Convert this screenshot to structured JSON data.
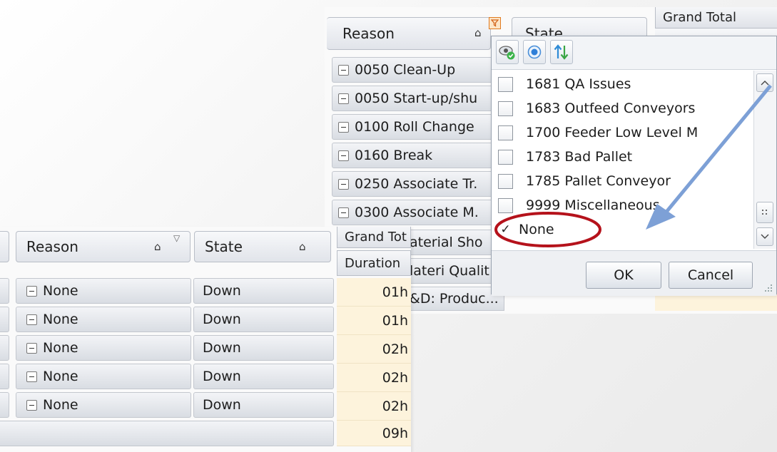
{
  "back_grid": {
    "reason_header": "Reason",
    "state_header": "State",
    "grand_total_header": "Grand Total",
    "grand_total_short": "Grand Tot",
    "duration_header": "Duration",
    "rows": [
      {
        "reason": "0050   Clean-Up"
      },
      {
        "reason": "0050 Start-up/shu"
      },
      {
        "reason": "0100 Roll Change"
      },
      {
        "reason": "0160 Break"
      },
      {
        "reason": "0250 Associate Tr."
      },
      {
        "reason": "0300 Associate M."
      }
    ],
    "peek_rows": [
      "aterial Sho",
      "lateri Qualit",
      "&D: Produc..."
    ]
  },
  "front_grid": {
    "reason_header": "Reason",
    "state_header": "State",
    "rows": [
      {
        "reason": "None",
        "state": "Down",
        "duration": "01h"
      },
      {
        "reason": "None",
        "state": "Down",
        "duration": "01h"
      },
      {
        "reason": "None",
        "state": "Down",
        "duration": "02h"
      },
      {
        "reason": "None",
        "state": "Down",
        "duration": "02h"
      },
      {
        "reason": "None",
        "state": "Down",
        "duration": "02h"
      }
    ],
    "total": "09h"
  },
  "filter_popup": {
    "items": [
      {
        "label": "1681 QA Issues",
        "checked": false
      },
      {
        "label": "1683 Outfeed Conveyors",
        "checked": false
      },
      {
        "label": "1700 Feeder Low Level M",
        "checked": false
      },
      {
        "label": "1783 Bad Pallet",
        "checked": false
      },
      {
        "label": "1785 Pallet Conveyor",
        "checked": false
      },
      {
        "label": "9999 Miscellaneous",
        "checked": false
      },
      {
        "label": "None",
        "checked": true
      }
    ],
    "check_mark": "✓",
    "ok_label": "OK",
    "cancel_label": "Cancel"
  },
  "colors": {
    "highlight_ellipse": "#b5121b",
    "arrow": "#7da0d6",
    "duration_cell": "#fdf3dc",
    "filter_icon_active": "#e07a1f"
  },
  "icons": {
    "sort": "sort-icon",
    "filter": "filter-icon",
    "show-checked": "eye-check-icon",
    "select-radio": "radio-icon",
    "invert": "swap-arrows-icon"
  }
}
